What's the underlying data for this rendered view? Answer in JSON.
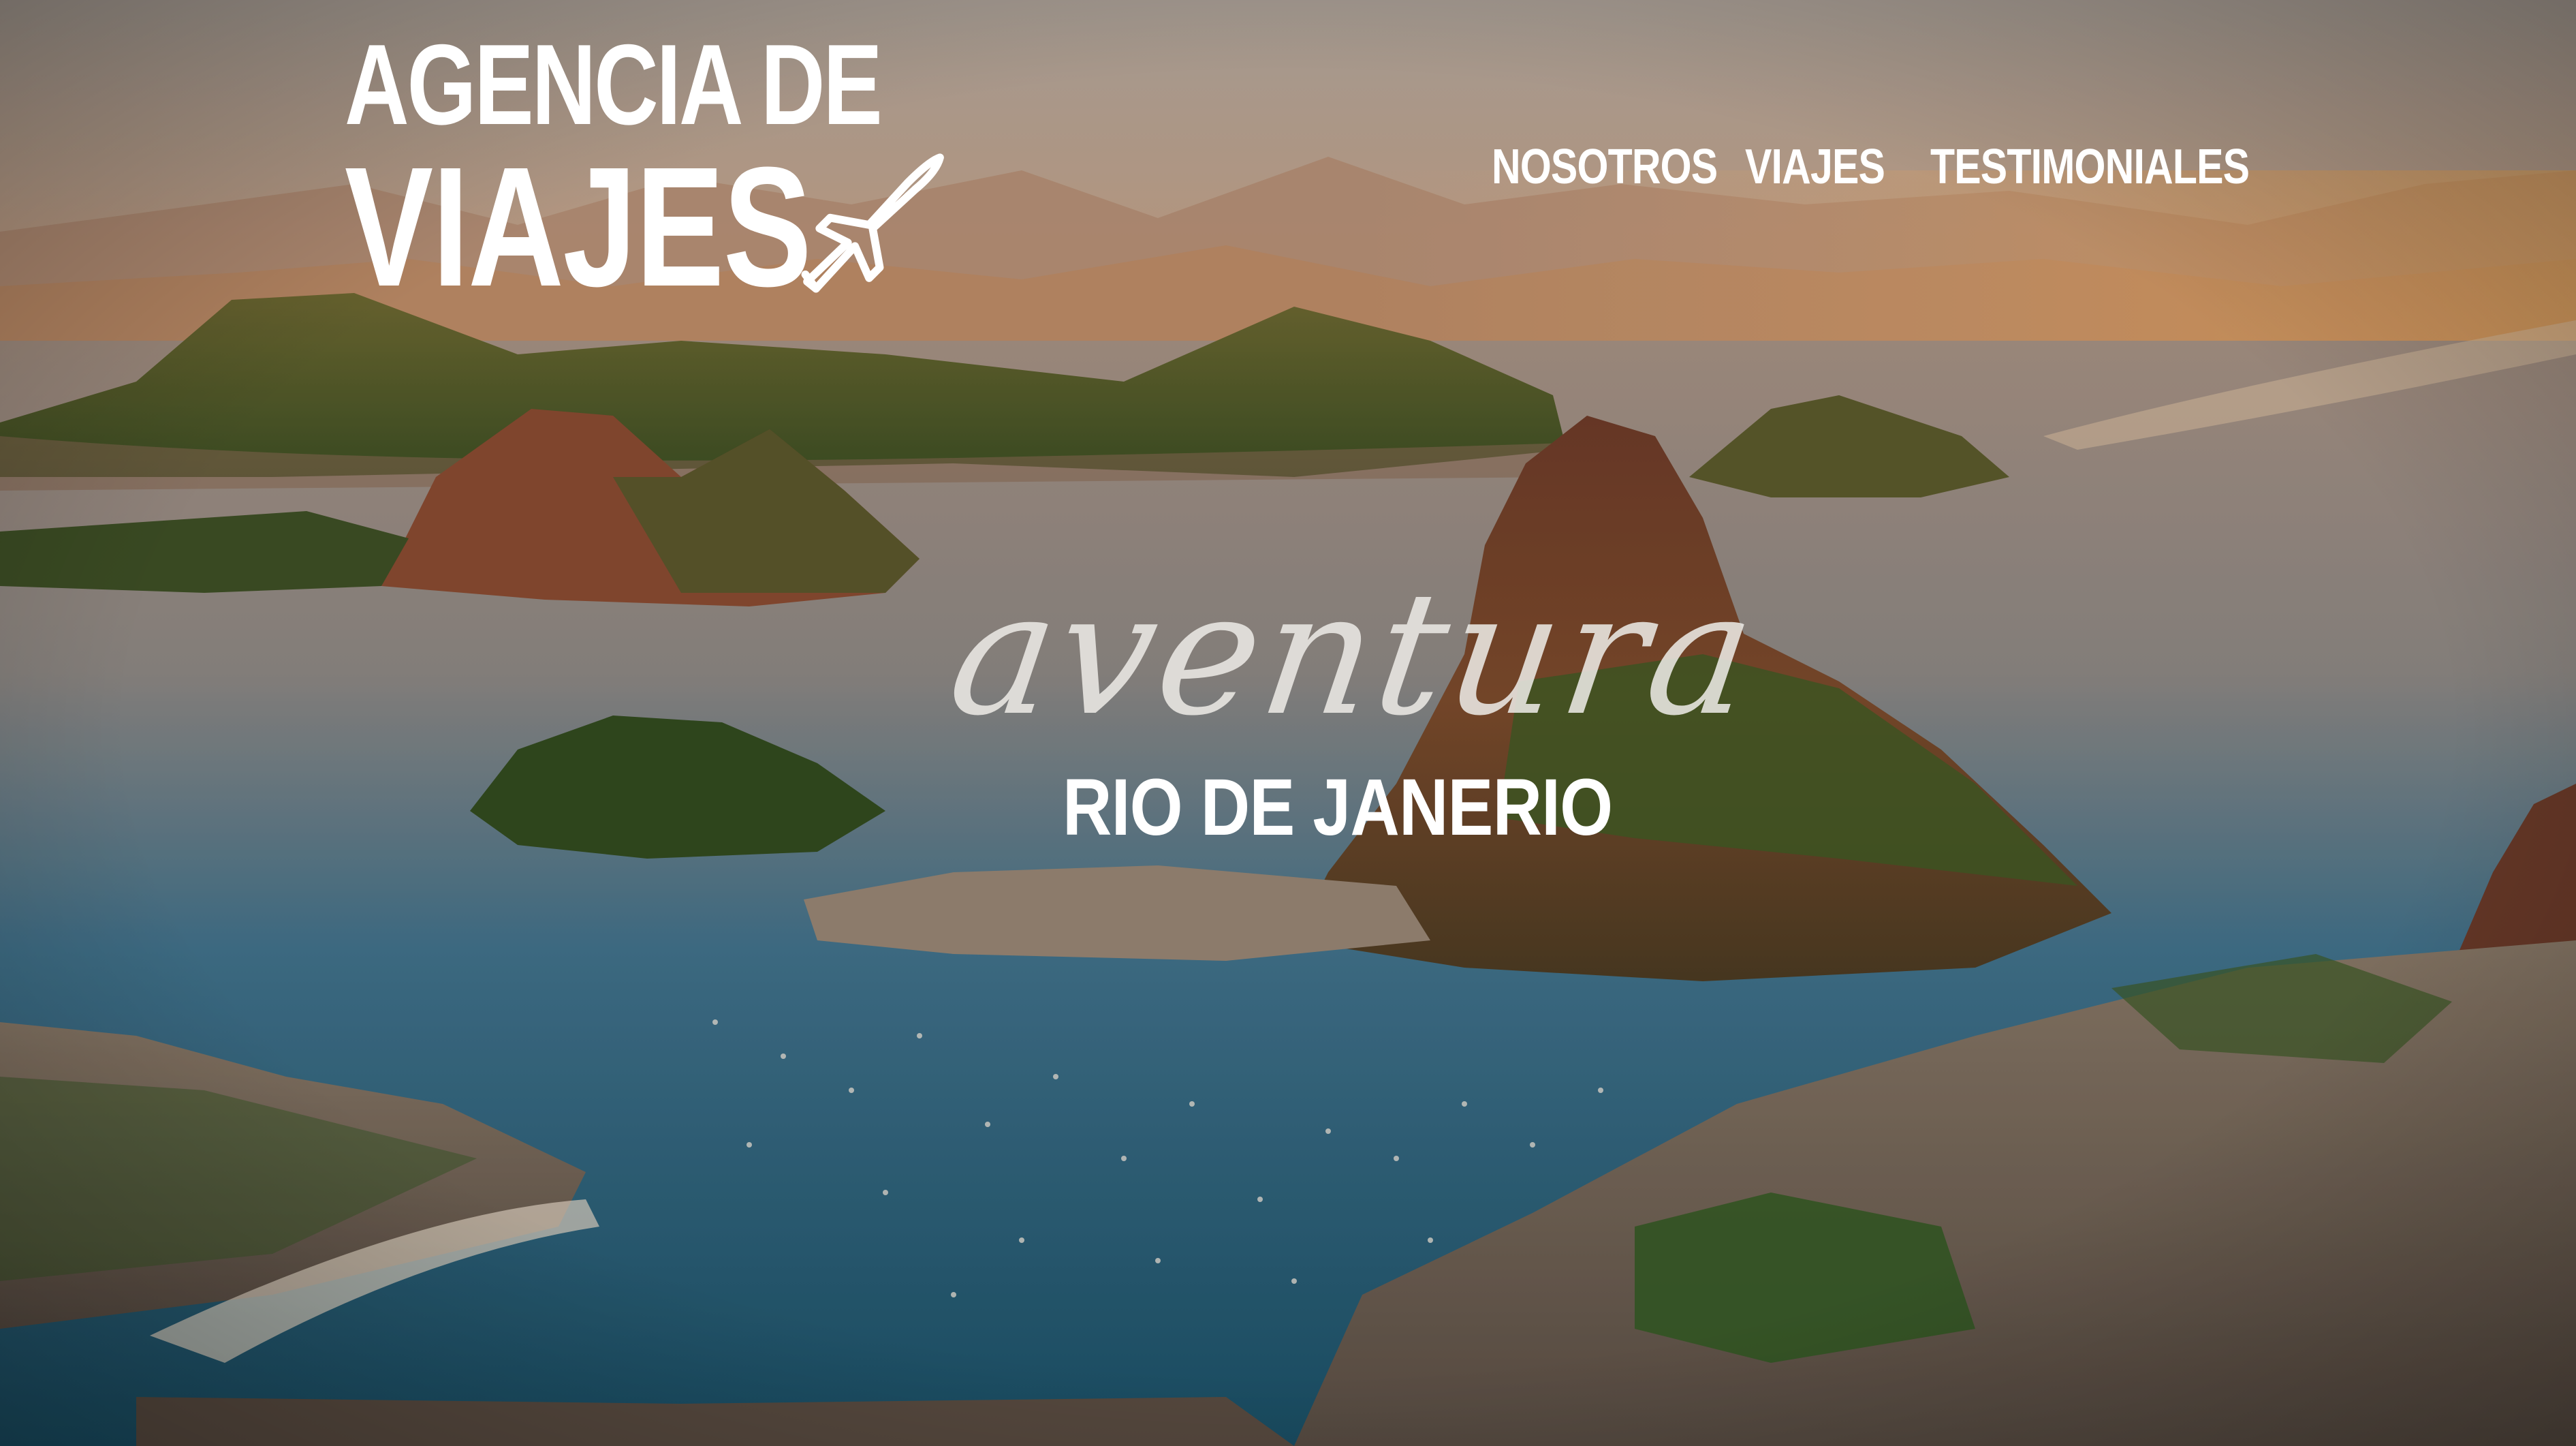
{
  "brand": {
    "line1": "AGENCIA DE",
    "line2": "VIAJES",
    "icon": "airplane-icon"
  },
  "nav": {
    "items": [
      {
        "label": "NOSOTROS"
      },
      {
        "label": "VIAJES"
      },
      {
        "label": "TESTIMONIALES"
      }
    ]
  },
  "hero": {
    "tagline": "aventura",
    "destination": "RIO DE JANERIO"
  },
  "colors": {
    "text": "#ffffff",
    "sea": "#1f6a86",
    "sky": "#b89a86",
    "mountain": "#8a4a2c",
    "vegetation": "#3d5a2a"
  }
}
